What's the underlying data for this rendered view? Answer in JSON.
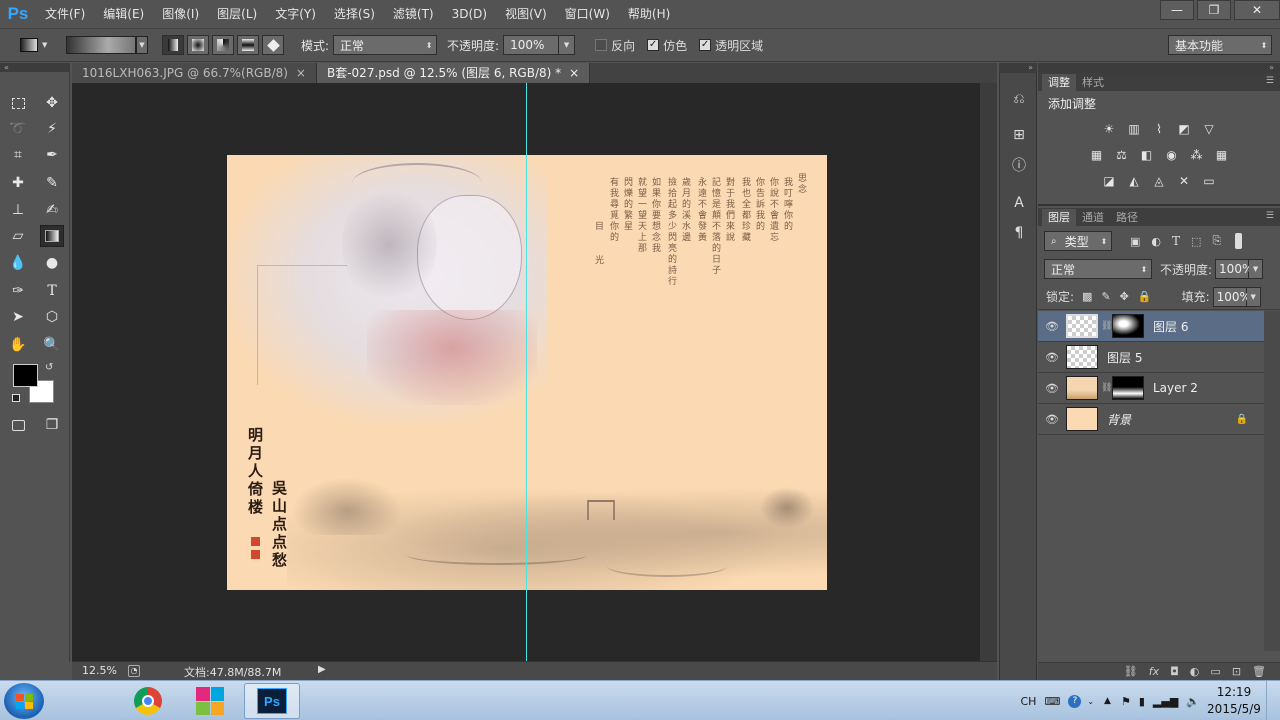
{
  "app": {
    "logo": "Ps"
  },
  "menu": [
    "文件(F)",
    "编辑(E)",
    "图像(I)",
    "图层(L)",
    "文字(Y)",
    "选择(S)",
    "滤镜(T)",
    "3D(D)",
    "视图(V)",
    "窗口(W)",
    "帮助(H)"
  ],
  "window_controls": {
    "minimize": "—",
    "restore": "❐",
    "close": "✕"
  },
  "options": {
    "mode_label": "模式:",
    "mode_value": "正常",
    "opacity_label": "不透明度:",
    "opacity_value": "100%",
    "reverse_label": "反向",
    "reverse_checked": false,
    "dither_label": "仿色",
    "dither_checked": true,
    "transparency_label": "透明区域",
    "transparency_checked": true,
    "workspace": "基本功能"
  },
  "tabs": [
    {
      "label": "1016LXH063.JPG @ 66.7%(RGB/8)",
      "close": "×"
    },
    {
      "label": "B套-027.psd @ 12.5% (图层 6, RGB/8) *",
      "close": "×"
    }
  ],
  "status": {
    "zoom": "12.5%",
    "doc_info": "文档:47.8M/88.7M"
  },
  "artwork": {
    "poem_columns": [
      "思念",
      "我叮嚀你的",
      "你說不會遺忘",
      "你告訴我的",
      "我也全都珍藏",
      "對于我們來說",
      "記憶是顛不落的日子",
      "永遠不會發黃",
      "歲月的溪水邊",
      "撿拾起多少閃亮的詩行",
      "如果你要想念我",
      "就望一望天上那",
      "閃爍的繁星",
      "有我尋覓你的",
      "目",
      "光"
    ],
    "title_text": "明月人倚楼",
    "author_text": "吳山点点愁",
    "guide_color": "#4ee3e3"
  },
  "adjustments": {
    "tabs": [
      "调整",
      "样式"
    ],
    "title": "添加调整",
    "row1": [
      "brightness-icon",
      "levels-icon",
      "curves-icon",
      "exposure-icon",
      "vibrance-icon"
    ],
    "row2": [
      "hue-icon",
      "balance-icon",
      "bw-icon",
      "photo-filter-icon",
      "channel-mixer-icon",
      "lookup-icon"
    ],
    "row3": [
      "invert-icon",
      "posterize-icon",
      "threshold-icon",
      "selective-color-icon",
      "gradient-map-icon"
    ]
  },
  "layers_panel": {
    "tabs": [
      "图层",
      "通道",
      "路径"
    ],
    "filter_kind": "类型",
    "blend_mode": "正常",
    "opacity_label": "不透明度:",
    "opacity_value": "100%",
    "lock_label": "锁定:",
    "fill_label": "填充:",
    "fill_value": "100%",
    "layers": [
      {
        "name": "图层 6",
        "selected": true,
        "has_mask": true
      },
      {
        "name": "图层 5",
        "selected": false,
        "has_mask": false
      },
      {
        "name": "Layer 2",
        "selected": false,
        "has_mask": true
      },
      {
        "name": "背景",
        "selected": false,
        "has_mask": false,
        "locked": true
      }
    ]
  },
  "taskbar": {
    "apps": [
      "chrome",
      "store",
      "photoshop"
    ],
    "lang": "CH",
    "time": "12:19",
    "date": "2015/5/9"
  }
}
